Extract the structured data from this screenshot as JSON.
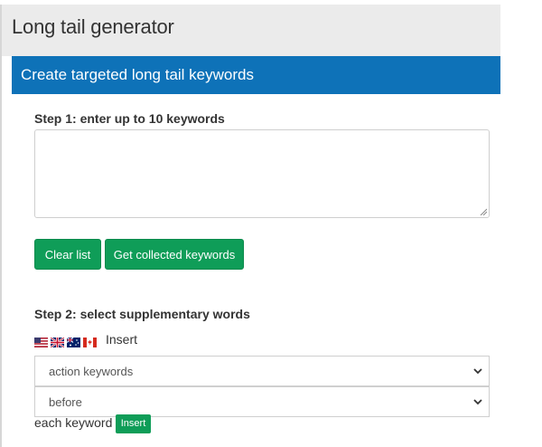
{
  "header": {
    "title": "Long tail generator"
  },
  "card": {
    "title": "Create targeted long tail keywords"
  },
  "step1": {
    "label": "Step 1: enter up to 10 keywords",
    "textarea_value": "",
    "clear_label": "Clear list",
    "collect_label": "Get collected keywords"
  },
  "step2": {
    "label": "Step 2: select supplementary words",
    "flags": [
      "us-flag-icon",
      "uk-flag-icon",
      "au-flag-icon",
      "ca-flag-icon"
    ],
    "insert_text": "Insert",
    "select_type_value": "action keywords",
    "select_position_value": "before",
    "each_keyword_text": "each keyword",
    "insert_button_label": "Insert"
  },
  "colors": {
    "header_bg": "#ebebeb",
    "card_header_bg": "#0e72b8",
    "button_green": "#0f9d58"
  }
}
